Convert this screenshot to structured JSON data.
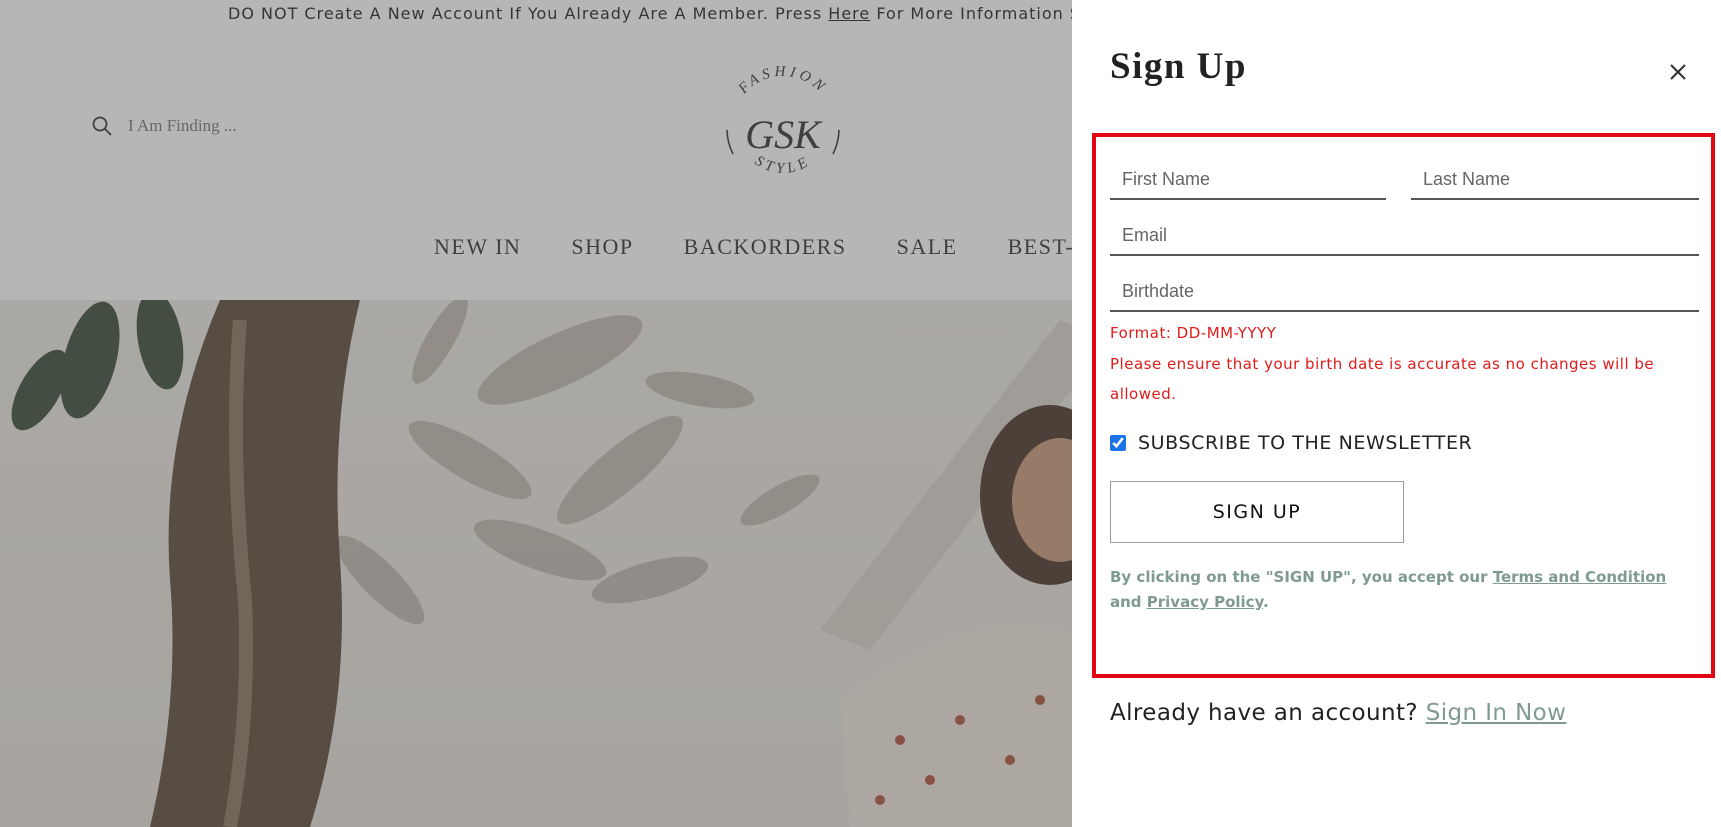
{
  "announcement": {
    "prefix": "DO NOT Create A New Account If You Already Are A Member. Press ",
    "link": "Here",
    "suffix": " For More Information So We Can"
  },
  "header": {
    "search_placeholder": "I Am Finding ...",
    "logo": {
      "top_text": "FASHION",
      "monogram": "GSK",
      "bottom_text": "STYLE"
    },
    "nav": [
      "NEW IN",
      "SHOP",
      "BACKORDERS",
      "SALE",
      "BEST-SE"
    ]
  },
  "drawer": {
    "title": "Sign Up",
    "form": {
      "first_name_placeholder": "First Name",
      "last_name_placeholder": "Last Name",
      "email_placeholder": "Email",
      "birthdate_placeholder": "Birthdate",
      "birthdate_format_hint": "Format: DD-MM-YYYY",
      "birthdate_warning": "Please ensure that your birth date is accurate as no changes will be allowed.",
      "newsletter_label": "SUBSCRIBE TO THE NEWSLETTER",
      "newsletter_checked": true,
      "submit_label": "SIGN UP",
      "legal_prefix": "By clicking on the \"SIGN UP\", you accept our ",
      "terms_label": "Terms and Condition",
      "legal_and": " and ",
      "privacy_label": "Privacy Policy",
      "legal_suffix": "."
    },
    "signin_prompt": "Already have an account? ",
    "signin_link": "Sign In Now"
  },
  "colors": {
    "accent_green": "#7f9a8e",
    "error_red": "#e01b1b",
    "highlight_red": "#e30613",
    "chat_green": "#25c25a"
  }
}
